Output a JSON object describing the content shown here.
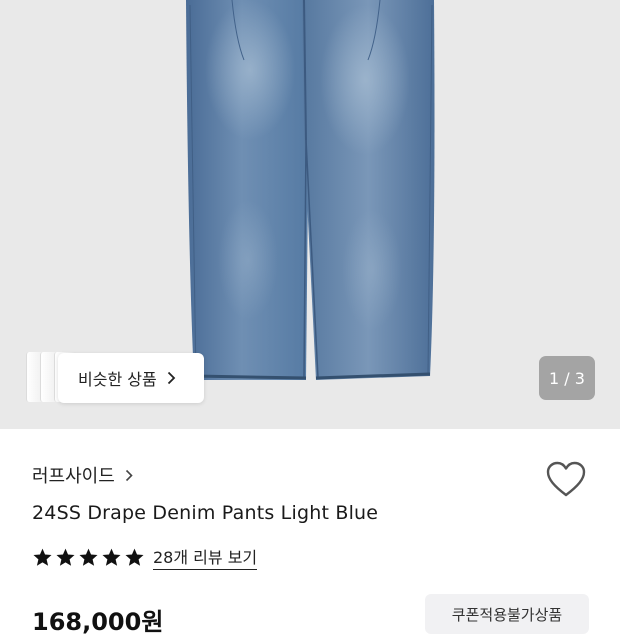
{
  "gallery": {
    "similar_label": "비슷한 상품",
    "counter": "1 / 3",
    "background_color": "#e9e9e9"
  },
  "product": {
    "brand": "러프사이드",
    "title": "24SS Drape Denim Pants Light Blue",
    "rating_stars": 5,
    "review_link": "28개 리뷰 보기",
    "price": "168,000원",
    "coupon_badge": "쿠폰적용불가상품"
  },
  "icons": {
    "brand_chevron": "chevron-right-icon",
    "similar_chevron": "chevron-right-icon",
    "wishlist": "heart-outline-icon",
    "star": "star-filled-icon"
  }
}
